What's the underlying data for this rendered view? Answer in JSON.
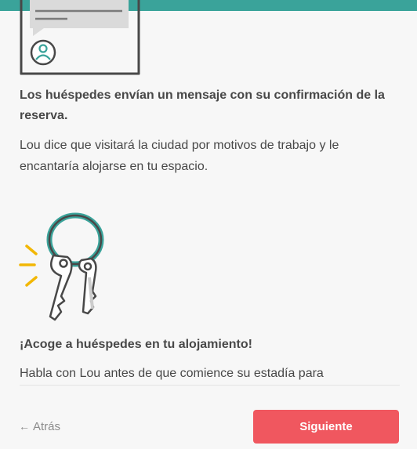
{
  "colors": {
    "accent_teal": "#3aa39a",
    "primary_button": "#f0575f",
    "key_highlight": "#f2b705",
    "text": "#484848",
    "muted_text": "#8a8a8a"
  },
  "message_section": {
    "title": "Los huéspedes envían un mensaje con su confirmación de la reserva.",
    "body": "Lou dice que visitará la ciudad por motivos de trabajo y le encantaría alojarse en tu espacio."
  },
  "host_section": {
    "title": "¡Acoge a huéspedes en tu alojamiento!",
    "body": "Habla con Lou antes de que comience su estadía para"
  },
  "footer": {
    "back_arrow": "←",
    "back_label": "Atrás",
    "next_label": "Siguiente"
  },
  "icons": {
    "phone": "phone-message-illustration",
    "user": "user-avatar-icon",
    "keys": "keys-illustration"
  }
}
